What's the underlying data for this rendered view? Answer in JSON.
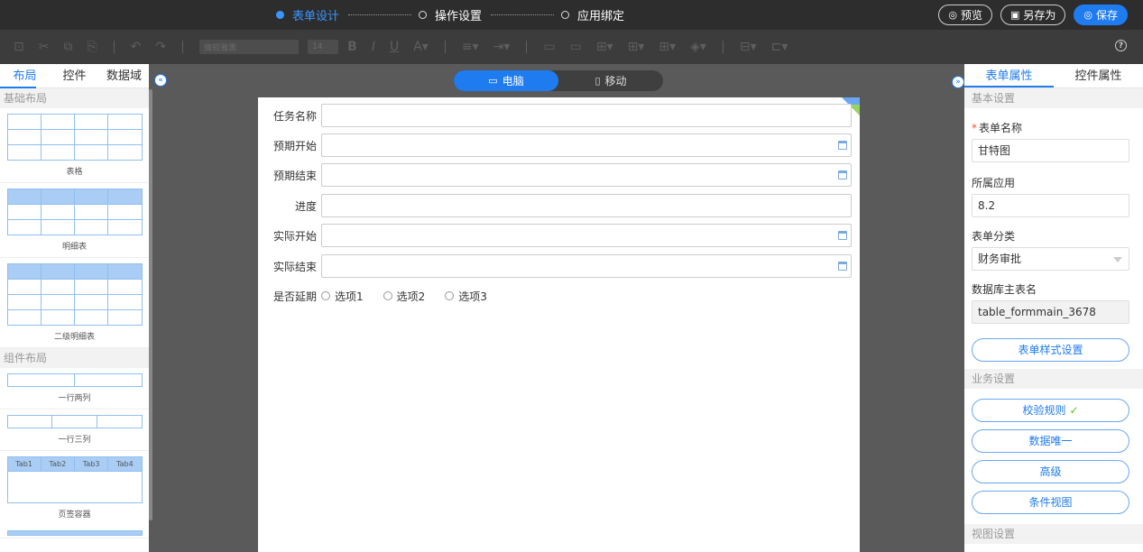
{
  "steps": [
    {
      "label": "表单设计",
      "active": true
    },
    {
      "label": "操作设置",
      "active": false
    },
    {
      "label": "应用绑定",
      "active": false
    }
  ],
  "actions": {
    "preview": "预览",
    "save_as": "另存为",
    "save": "保存"
  },
  "toolbar": {
    "font_placeholder": "微软雅黑",
    "font_size": "14"
  },
  "left": {
    "tabs": [
      "布局",
      "控件",
      "数据域"
    ],
    "sections": {
      "basic": "基础布局",
      "component": "组件布局"
    },
    "items": {
      "table": "表格",
      "detail": "明细表",
      "sub_detail": "二级明细表",
      "two_cols": "一行两列",
      "three_cols": "一行三列",
      "tab_container": "页签容器"
    },
    "tab_labels": [
      "Tab1",
      "Tab2",
      "Tab3",
      "Tab4"
    ]
  },
  "device": {
    "desktop": "电脑",
    "mobile": "移动"
  },
  "form": {
    "fields": [
      {
        "label": "任务名称",
        "value": ""
      },
      {
        "label": "预期开始",
        "value": ""
      },
      {
        "label": "预期结束",
        "value": ""
      },
      {
        "label": "进度",
        "value": ""
      },
      {
        "label": "实际开始",
        "value": ""
      },
      {
        "label": "实际结束",
        "value": ""
      }
    ],
    "radio_label": "是否延期",
    "radio_options": [
      "选项1",
      "选项2",
      "选项3"
    ]
  },
  "right": {
    "tabs": [
      "表单属性",
      "控件属性"
    ],
    "basic_section": "基本设置",
    "form_name_label": "表单名称",
    "form_name_value": "甘特图",
    "app_label": "所属应用",
    "app_value": "8.2",
    "category_label": "表单分类",
    "category_value": "财务审批",
    "db_table_label": "数据库主表名",
    "db_table_value": "table_formmain_3678",
    "style_button": "表单样式设置",
    "business_section": "业务设置",
    "validation_button": "校验规则",
    "unique_button": "数据唯一",
    "advanced_button": "高级",
    "condition_view_button": "条件视图",
    "view_section": "视图设置"
  }
}
